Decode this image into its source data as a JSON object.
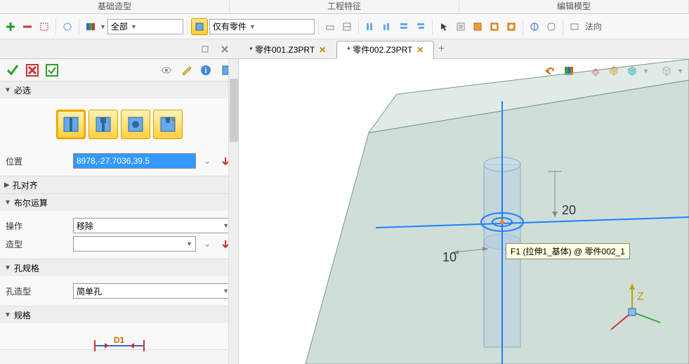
{
  "top_tabs": [
    "基础造型",
    "工程特征",
    "编辑模型"
  ],
  "ribbon": {
    "combo1": "全部",
    "combo2": "仅有零件",
    "normal_label": "法向"
  },
  "doc_tabs": [
    {
      "label": "* 零件001.Z3PRT",
      "active": false
    },
    {
      "label": "* 零件002.Z3PRT",
      "active": true
    }
  ],
  "panel": {
    "required": "必选",
    "position_label": "位置",
    "position_value": "8978,-27.7036,39.5",
    "align": "孔对齐",
    "boolean": "布尔运算",
    "op_label": "操作",
    "op_value": "移除",
    "shape_label": "造型",
    "hole_spec": "孔规格",
    "hole_type_label": "孔造型",
    "hole_type_value": "简单孔",
    "spec": "规格",
    "d1": "D1"
  },
  "viewport": {
    "dim20": "20",
    "dim10": "10",
    "axis_z": "Z",
    "tooltip": "F1 (拉伸1_基体) @ 零件002_1"
  }
}
